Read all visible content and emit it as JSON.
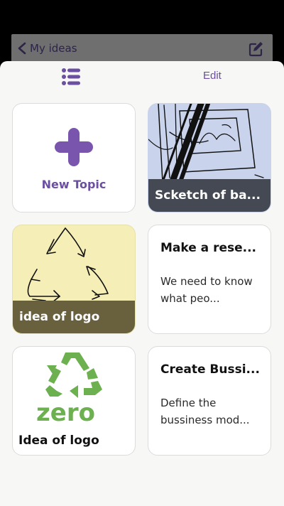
{
  "nav": {
    "back_label": "My ideas",
    "back_icon": "chevron-left-icon",
    "compose_icon": "compose-icon"
  },
  "toolbar": {
    "list_icon": "list-icon",
    "edit_label": "Edit"
  },
  "colors": {
    "accent": "#6b4fa1",
    "sheet_background": "#f7f7f5",
    "dimmed_bar": "#6f6f6f",
    "logo_green": "#6cb04f"
  },
  "cards": [
    {
      "type": "new",
      "label": "New Topic",
      "icon": "plus-icon"
    },
    {
      "type": "image",
      "title": "Scketch of ba...",
      "image": "sketch-drawing"
    },
    {
      "type": "image",
      "title": "idea of logo",
      "image": "recycle-sketch"
    },
    {
      "type": "text",
      "title": "Make a rese...",
      "body": "We need to know what peo..."
    },
    {
      "type": "logo",
      "title": "Idea of logo",
      "logo_text": "zero",
      "image": "recycle-logo"
    },
    {
      "type": "text",
      "title": "Create Bussi...",
      "body": "Define the bussiness mod..."
    }
  ]
}
